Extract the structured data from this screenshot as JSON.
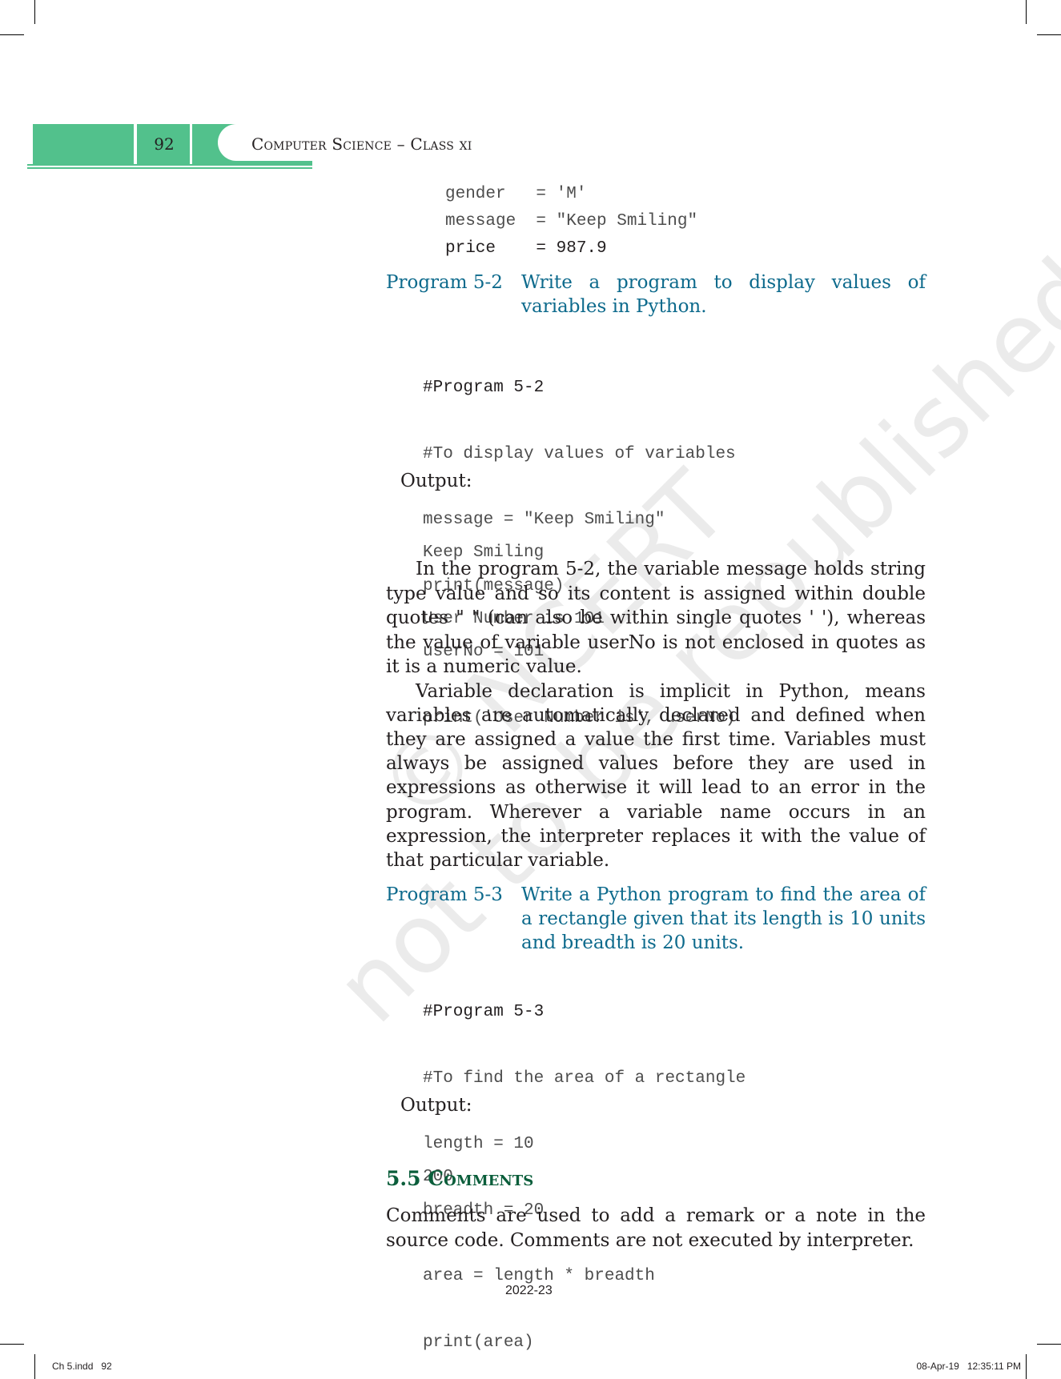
{
  "header": {
    "page_number": "92",
    "book_title": "Computer Science – Class xi",
    "accent_color": "#52c18c"
  },
  "watermark": {
    "line1": "© NCERT",
    "line2": "not to be republished"
  },
  "variable_examples": [
    {
      "text": "gender   = 'M'"
    },
    {
      "text": "message  = \"Keep Smiling\""
    },
    {
      "text": "price    = 987.9"
    }
  ],
  "program_5_2": {
    "label": "Program 5-2",
    "description": "Write a program to display values of variables in Python.",
    "code": [
      "#Program 5-2",
      "#To display values of variables",
      "message = \"Keep Smiling\"",
      "print(message)",
      "userNo = 101",
      "print('User Number is', userNo)"
    ],
    "output_label": "Output:",
    "output": [
      "Keep Smiling",
      "User Number is 101"
    ]
  },
  "paragraphs": [
    "In the program 5-2, the variable message holds string type value and so its content is assigned within double quotes \" \" (can also be within single quotes ' '), whereas the value of variable userNo is not enclosed in quotes as it is a numeric value.",
    "Variable declaration is implicit in Python, means variables are automatically declared and defined when they are assigned a value the first time. Variables must always be assigned values before they are used in expressions as otherwise it will lead to an error in the program. Wherever a variable name occurs in an expression, the interpreter replaces it with the value of that particular variable."
  ],
  "program_5_3": {
    "label": "Program 5-3",
    "description": "Write a Python program to find the area of a rectangle given that its length is 10 units and breadth is 20 units.",
    "code": [
      "#Program 5-3",
      "#To find the area of a rectangle",
      "length = 10",
      "breadth = 20",
      "area = length * breadth",
      "print(area)"
    ],
    "output_label": "Output:",
    "output": [
      "200"
    ]
  },
  "section": {
    "heading": "5.5 Comments",
    "text": "Comments are used to add a remark or a note in the source code. Comments are not executed by interpreter."
  },
  "footer": {
    "year": "2022-23",
    "slug_left": "Ch 5.indd   92",
    "slug_right": "08-Apr-19   12:35:11 PM"
  }
}
